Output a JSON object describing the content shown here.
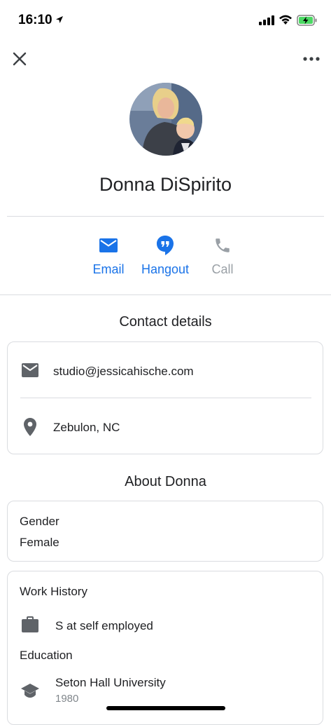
{
  "status_bar": {
    "time": "16:10"
  },
  "header": {
    "close_icon": "close-icon",
    "more_icon": "more-horizontal-icon"
  },
  "profile": {
    "name": "Donna DiSpirito"
  },
  "actions": [
    {
      "label": "Email",
      "icon": "email-icon",
      "color": "#1a73e8"
    },
    {
      "label": "Hangout",
      "icon": "hangout-icon",
      "color": "#1a73e8"
    },
    {
      "label": "Call",
      "icon": "phone-icon",
      "color": "#9aa0a6"
    }
  ],
  "contact_details": {
    "title": "Contact details",
    "email": "studio@jessicahische.com",
    "location": "Zebulon, NC"
  },
  "about": {
    "title": "About Donna",
    "gender_label": "Gender",
    "gender_value": "Female",
    "work_history_label": "Work History",
    "work_value": "S at self employed",
    "education_label": "Education",
    "education_school": "Seton Hall University",
    "education_year": "1980"
  },
  "colors": {
    "accent": "#1a73e8",
    "disabled": "#9aa0a6",
    "icon_gray": "#5f6368",
    "divider": "#dadce0"
  }
}
